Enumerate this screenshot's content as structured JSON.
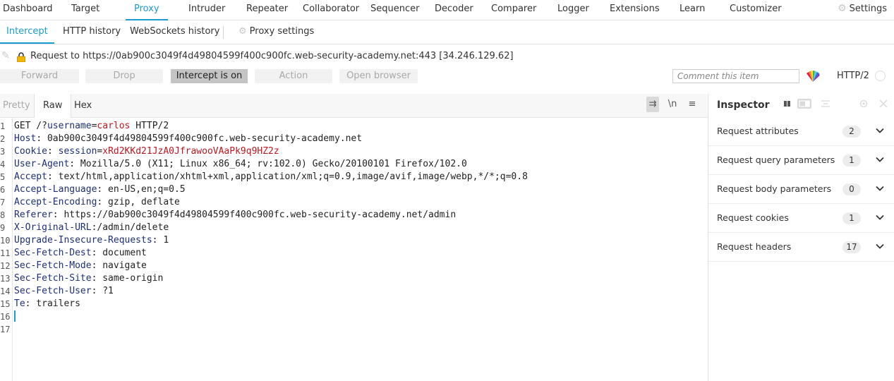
{
  "top_nav": {
    "items": [
      "Dashboard",
      "Target",
      "Proxy",
      "Intruder",
      "Repeater",
      "Collaborator",
      "Sequencer",
      "Decoder",
      "Comparer",
      "Logger",
      "Extensions",
      "Learn",
      "Customizer"
    ],
    "active": "Proxy",
    "settings_label": "Settings"
  },
  "sub_nav": {
    "items": [
      "Intercept",
      "HTTP history",
      "WebSockets history"
    ],
    "active": "Intercept",
    "proxy_settings_label": "Proxy settings"
  },
  "request_info": {
    "text": "Request to https://0ab900c3049f4d49804599f400c900fc.web-security-academy.net:443  [34.246.129.62]"
  },
  "toolbar": {
    "forward": "Forward",
    "drop": "Drop",
    "intercept": "Intercept is on",
    "action": "Action",
    "open_browser": "Open browser",
    "comment_placeholder": "Comment this item",
    "http_version": "HTTP/2"
  },
  "editor": {
    "tabs": [
      "Pretty",
      "Raw",
      "Hex"
    ],
    "active_tab": "Raw",
    "newline_toggle": "\\n",
    "lines": [
      {
        "n": "1",
        "method": "GET",
        "path_prefix": " /?",
        "param_name": "username",
        "eq": "=",
        "param_value": "carlos",
        "rest": " HTTP/2"
      },
      {
        "n": "2",
        "name": "Host",
        "value": " 0ab900c3049f4d49804599f400c900fc.web-security-academy.net"
      },
      {
        "n": "3",
        "name": "Cookie",
        "cookie_name": " session",
        "eq": "=",
        "cookie_value": "xRd2KKd21JzA0JfrawooVAaPk9q9HZ2z"
      },
      {
        "n": "4",
        "name": "User-Agent",
        "value": " Mozilla/5.0 (X11; Linux x86_64; rv:102.0) Gecko/20100101 Firefox/102.0"
      },
      {
        "n": "5",
        "name": "Accept",
        "value": " text/html,application/xhtml+xml,application/xml;q=0.9,image/avif,image/webp,*/*;q=0.8"
      },
      {
        "n": "6",
        "name": "Accept-Language",
        "value": " en-US,en;q=0.5"
      },
      {
        "n": "7",
        "name": "Accept-Encoding",
        "value": " gzip, deflate"
      },
      {
        "n": "8",
        "name": "Referer",
        "value": " https://0ab900c3049f4d49804599f400c900fc.web-security-academy.net/admin"
      },
      {
        "n": "9",
        "name": "X-Original-URL",
        "value": "/admin/delete"
      },
      {
        "n": "10",
        "name": "Upgrade-Insecure-Requests",
        "value": " 1"
      },
      {
        "n": "11",
        "name": "Sec-Fetch-Dest",
        "value": " document"
      },
      {
        "n": "12",
        "name": "Sec-Fetch-Mode",
        "value": " navigate"
      },
      {
        "n": "13",
        "name": "Sec-Fetch-Site",
        "value": " same-origin"
      },
      {
        "n": "14",
        "name": "Sec-Fetch-User",
        "value": " ?1"
      },
      {
        "n": "15",
        "name": "Te",
        "value": " trailers"
      },
      {
        "n": "16"
      },
      {
        "n": "17"
      }
    ]
  },
  "inspector": {
    "title": "Inspector",
    "rows": [
      {
        "label": "Request attributes",
        "count": "2"
      },
      {
        "label": "Request query parameters",
        "count": "1"
      },
      {
        "label": "Request body parameters",
        "count": "0"
      },
      {
        "label": "Request cookies",
        "count": "1"
      },
      {
        "label": "Request headers",
        "count": "17"
      }
    ]
  },
  "colors": {
    "accent": "#1c9bd0",
    "header_name": "#1e2f7a",
    "param_value": "#c0161f"
  }
}
